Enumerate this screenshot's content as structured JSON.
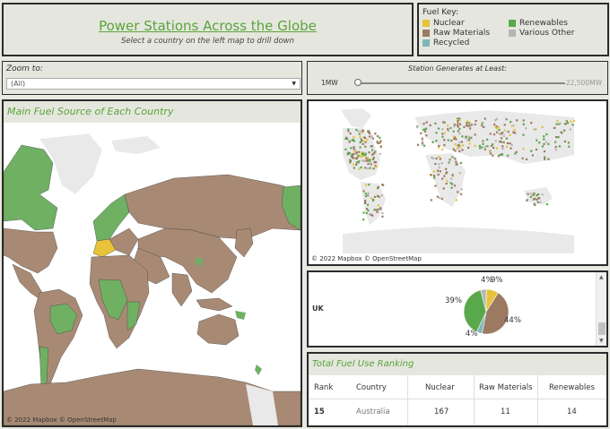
{
  "header": {
    "title": "Power Stations Across the Globe",
    "subtitle": "Select a country on the left map to drill down"
  },
  "fuel_key": {
    "title": "Fuel Key:",
    "items": [
      {
        "label": "Nuclear",
        "color": "#e8c23a"
      },
      {
        "label": "Renewables",
        "color": "#5aa84c"
      },
      {
        "label": "Raw Materials",
        "color": "#9c7a62"
      },
      {
        "label": "Various Other",
        "color": "#b5b5b5"
      },
      {
        "label": "Recycled",
        "color": "#7fb7b8"
      }
    ]
  },
  "zoom": {
    "label": "Zoom to:",
    "selected": "(All)"
  },
  "slider": {
    "label": "Station Generates at Least:",
    "min_label": "1MW",
    "max_label": "22,500MW",
    "level_fraction": 0.0
  },
  "country_map": {
    "header": "Main Fuel Source of Each Country",
    "attribution": "© 2022 Mapbox © OpenStreetMap"
  },
  "station_map": {
    "attribution": "© 2022 Mapbox © OpenStreetMap"
  },
  "pie": {
    "country": "UK",
    "labels": {
      "nuclear": "9%",
      "raw": "44%",
      "recycled": "4%",
      "renewables": "39%",
      "other": "4%"
    }
  },
  "ranking": {
    "header": "Total Fuel Use Ranking",
    "columns": [
      "Rank",
      "Country",
      "Nuclear",
      "Raw Materials",
      "Renewables"
    ],
    "rows": [
      {
        "rank": "15",
        "country": "Australia",
        "nuclear": "167",
        "raw": "11",
        "renewables": "14"
      }
    ]
  },
  "chart_data": {
    "type": "pie",
    "title": "",
    "categories": [
      "Nuclear",
      "Raw Materials",
      "Recycled",
      "Renewables",
      "Various Other"
    ],
    "values": [
      9,
      44,
      4,
      39,
      4
    ],
    "colors": [
      "#e8c23a",
      "#9c7a62",
      "#7fb7b8",
      "#5aa84c",
      "#b5b5b5"
    ]
  },
  "colors": {
    "accent_green": "#5aa33c",
    "land_raw": "#a88a74",
    "land_renew": "#6fb063",
    "land_none": "#e9e9e9"
  }
}
